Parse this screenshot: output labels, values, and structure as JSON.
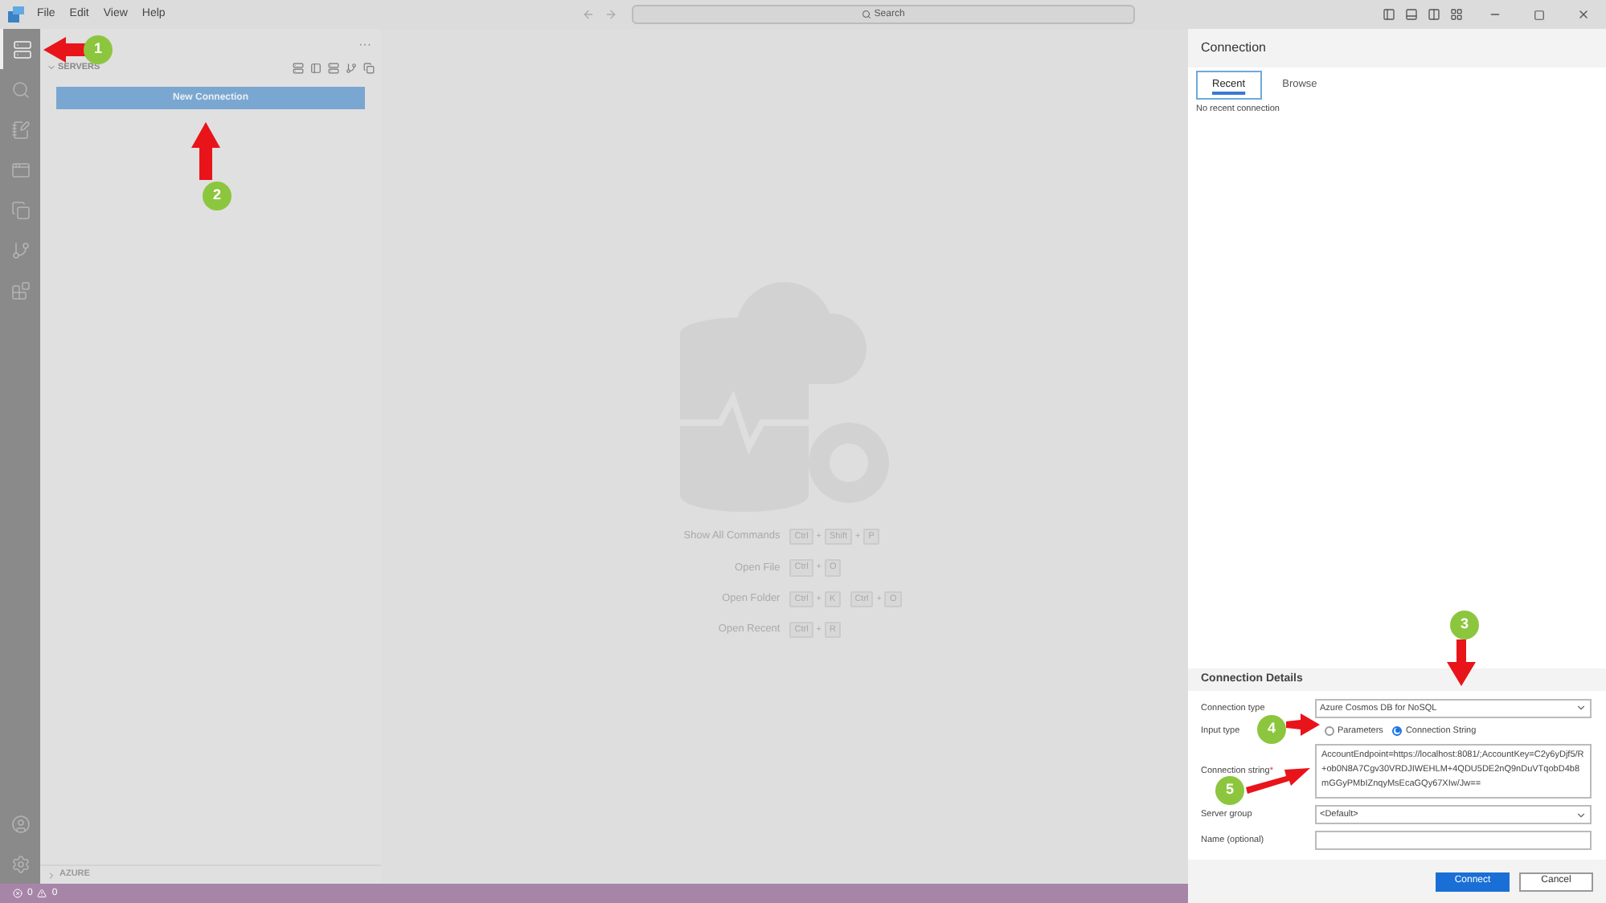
{
  "title_bar": {
    "menu": [
      "File",
      "Edit",
      "View",
      "Help"
    ],
    "search": "Search"
  },
  "activity_bar": {
    "items": [
      {
        "kind": "server",
        "selected": true
      },
      {
        "kind": "search",
        "selected": false
      },
      {
        "kind": "notebook",
        "selected": false
      },
      {
        "kind": "window",
        "selected": false
      },
      {
        "kind": "copy",
        "selected": false
      },
      {
        "kind": "branch",
        "selected": false
      },
      {
        "kind": "extensions",
        "selected": false
      }
    ],
    "bottom": [
      {
        "kind": "account"
      },
      {
        "kind": "settings"
      }
    ]
  },
  "sidebar": {
    "more": "···",
    "section": "SERVERS",
    "section_expanded": true,
    "new_connection": "New Connection",
    "footer_section": "AZURE",
    "footer_expanded": false
  },
  "editor": {
    "key_joiner": "+",
    "shortcuts": [
      {
        "label": "Show All Commands",
        "chords": [
          [
            "Ctrl",
            "Shift",
            "P"
          ]
        ]
      },
      {
        "label": "Open File",
        "chords": [
          [
            "Ctrl",
            "O"
          ]
        ]
      },
      {
        "label": "Open Folder",
        "chords": [
          [
            "Ctrl",
            "K"
          ],
          [
            "Ctrl",
            "O"
          ]
        ]
      },
      {
        "label": "Open Recent",
        "chords": [
          [
            "Ctrl",
            "R"
          ]
        ]
      }
    ]
  },
  "status_bar": {
    "errors": "0",
    "warnings": "0"
  },
  "connection_panel": {
    "title": "Connection",
    "tabs": [
      {
        "label": "Recent",
        "selected": true
      },
      {
        "label": "Browse",
        "selected": false
      }
    ],
    "empty_message": "No recent connection",
    "details": {
      "title": "Connection Details",
      "fields": [
        {
          "kind": "select",
          "label": "Connection type",
          "value": "Azure Cosmos DB for NoSQL"
        },
        {
          "kind": "radio",
          "label": "Input type",
          "options": [
            {
              "label": "Parameters",
              "selected": false
            },
            {
              "label": "Connection String",
              "selected": true
            }
          ]
        },
        {
          "kind": "textarea",
          "label": "Connection string",
          "required_mark": "*",
          "value": "AccountEndpoint=https://localhost:8081/;AccountKey=C2y6yDjf5/R+ob0N8A7Cgv30VRDJIWEHLM+4QDU5DE2nQ9nDuVTqobD4b8mGGyPMbIZnqyMsEcaGQy67XIw/Jw=="
        },
        {
          "kind": "select",
          "label": "Server group",
          "value": "<Default>"
        },
        {
          "kind": "text",
          "label": "Name (optional)"
        }
      ]
    },
    "buttons": [
      {
        "label": "Connect",
        "kind": "primary"
      },
      {
        "label": "Cancel",
        "kind": "secondary"
      }
    ]
  },
  "annotations": [
    {
      "label": "1"
    },
    {
      "label": "2"
    },
    {
      "label": "3"
    },
    {
      "label": "4"
    },
    {
      "label": "5"
    }
  ]
}
